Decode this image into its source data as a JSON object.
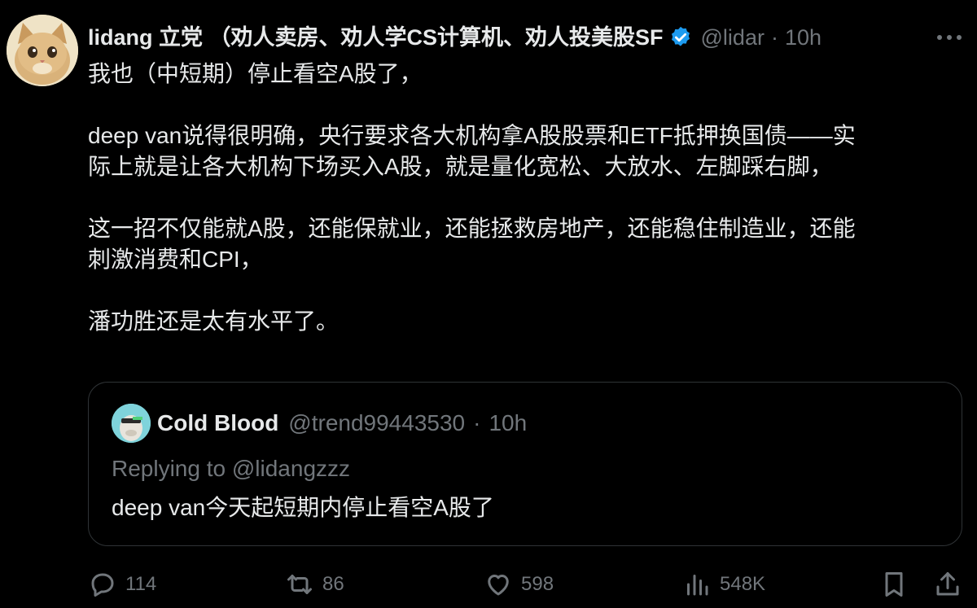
{
  "author": {
    "display_name": "lidang 立党 （劝人卖房、劝人学CS计算机、劝人投美股SF",
    "handle": "@lidar",
    "dot": "·",
    "time": "10h"
  },
  "tweet": {
    "lines": [
      "我也（中短期）停止看空A股了，",
      "",
      "deep van说得很明确，央行要求各大机构拿A股股票和ETF抵押换国债——实",
      "际上就是让各大机构下场买入A股，就是量化宽松、大放水、左脚踩右脚，",
      "",
      "这一招不仅能就A股，还能保就业，还能拯救房地产，还能稳住制造业，还能",
      "刺激消费和CPI，",
      "",
      "潘功胜还是太有水平了。"
    ]
  },
  "quote": {
    "name": "Cold Blood",
    "handle": "@trend99443530",
    "dot": "·",
    "time": "10h",
    "replying": "Replying to @lidangzzz",
    "text": "deep van今天起短期内停止看空A股了"
  },
  "actions": {
    "replies": "114",
    "reposts": "86",
    "likes": "598",
    "views": "548K"
  },
  "colors": {
    "background": "#000000",
    "text": "#e7e9ea",
    "muted": "#71767b",
    "verified": "#1d9bf0",
    "border": "#2f3336"
  },
  "icons": {
    "verified": "verified-badge-icon",
    "more": "more-dots-icon",
    "reply": "reply-icon",
    "repost": "repost-icon",
    "like": "heart-icon",
    "views": "views-icon",
    "bookmark": "bookmark-icon",
    "share": "share-icon"
  }
}
